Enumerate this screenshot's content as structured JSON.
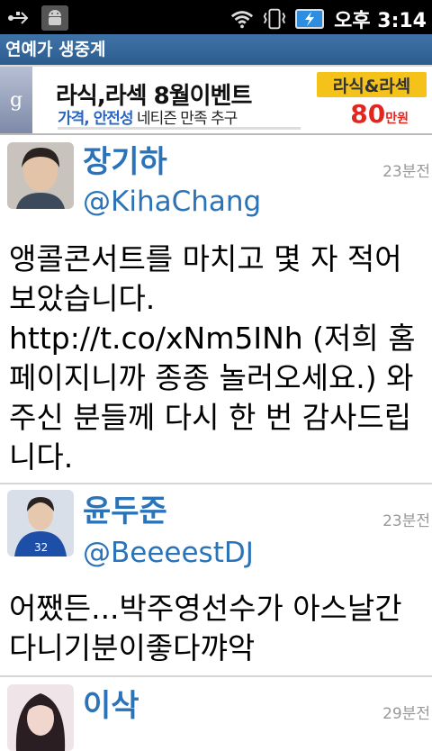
{
  "status_bar": {
    "icons": [
      "usb-icon",
      "android-icon",
      "wifi-icon",
      "vibrate-icon",
      "battery-icon"
    ],
    "time": "오후 3:14"
  },
  "app": {
    "title": "연예가 생중계"
  },
  "banner": {
    "headline": "라식,라섹 8월이벤트",
    "sub_blue": "가격, 안전성",
    "sub_rest": " 네티즌 만족 추구",
    "brand": "라식&라섹",
    "price_number": "80",
    "price_unit": "만원"
  },
  "tweets": [
    {
      "name": "장기하",
      "handle": "@KihaChang",
      "time": "23분전",
      "text": "앵콜콘서트를 마치고 몇 자 적어보았습니다. http://t.co/xNm5INh (저희 홈페이지니까 종종 놀러오세요.) 와주신 분들께 다시 한 번 감사드립니다."
    },
    {
      "name": "윤두준",
      "handle": "@BeeeestDJ",
      "time": "23분전",
      "text": "어쨌든...박주영선수가 아스날간다니기분이좋다꺄악"
    },
    {
      "name": "이삭",
      "handle": "",
      "time": "29분전",
      "text": ""
    }
  ],
  "colors": {
    "title_bar": "#2c5c8e",
    "link_blue": "#2a73b8",
    "time_gray": "#999999"
  }
}
